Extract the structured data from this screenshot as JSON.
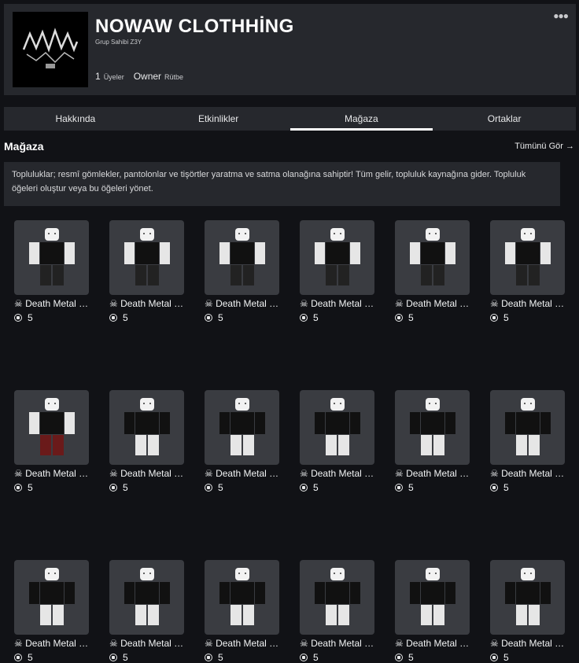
{
  "group": {
    "name": "NOWAW CLOTHHİNG",
    "owner_line": "Grup Sahibi Z3Y",
    "member_count": "1",
    "members_label": "Üyeler",
    "rank": "Owner",
    "rank_label": "Rütbe",
    "menu_icon": "more-dots"
  },
  "tabs": [
    {
      "label": "Hakkında",
      "active": false
    },
    {
      "label": "Etkinlikler",
      "active": false
    },
    {
      "label": "Mağaza",
      "active": true
    },
    {
      "label": "Ortaklar",
      "active": false
    }
  ],
  "store": {
    "title": "Mağaza",
    "see_all": "Tümünü Gör →",
    "description": "Topluluklar; resmî gömlekler, pantolonlar ve tişörtler yaratma ve satma olanağına sahiptir! Tüm gelir, topluluk kaynağına gider. Topluluk öğeleri oluştur veya bu öğeleri yönet."
  },
  "items": [
    {
      "name": "☠ Death Metal Pant NOWAW…",
      "price": "5",
      "kind": "pant"
    },
    {
      "name": "☠ Death Metal Pant NOWAW…",
      "price": "5",
      "kind": "pant"
    },
    {
      "name": "☠ Death Metal Pant NOWAW…",
      "price": "5",
      "kind": "pant"
    },
    {
      "name": "☠ Death Metal Pant NOWAW…",
      "price": "5",
      "kind": "pant"
    },
    {
      "name": "☠ Death Metal Pant NOWAW…",
      "price": "5",
      "kind": "pant"
    },
    {
      "name": "☠ Death Metal Pant NOWAW…",
      "price": "5",
      "kind": "pant"
    },
    {
      "name": "☠ Death Metal Pant NOWAW…",
      "price": "5",
      "kind": "pant-red"
    },
    {
      "name": "☠ Death Metal Shirt NOWAW…",
      "price": "5",
      "kind": "shirt"
    },
    {
      "name": "☠ Death Metal Shirt NOWAW…",
      "price": "5",
      "kind": "shirt"
    },
    {
      "name": "☠ Death Metal Shirt NOWAW…",
      "price": "5",
      "kind": "shirt"
    },
    {
      "name": "☠ Death Metal Shirt NOWAW…",
      "price": "5",
      "kind": "shirt"
    },
    {
      "name": "☠ Death Metal Shirt NOWAW…",
      "price": "5",
      "kind": "shirt"
    },
    {
      "name": "☠ Death Metal Shirt NOWAW…",
      "price": "5",
      "kind": "shirt"
    },
    {
      "name": "☠ Death Metal Shirt NOWAW…",
      "price": "5",
      "kind": "shirt"
    },
    {
      "name": "☠ Death Metal Shirt NOWAW…",
      "price": "5",
      "kind": "shirt"
    },
    {
      "name": "☠ Death Metal Shirt NOWAW…",
      "price": "5",
      "kind": "shirt"
    },
    {
      "name": "☠ Death Metal Shirt NOWAW…",
      "price": "5",
      "kind": "shirt"
    },
    {
      "name": "☠ Death Metal Shirt NOWAW…",
      "price": "5",
      "kind": "shirt"
    }
  ],
  "colors": {
    "background": "#111216",
    "panel": "#26282d",
    "thumb": "#3a3c41"
  }
}
